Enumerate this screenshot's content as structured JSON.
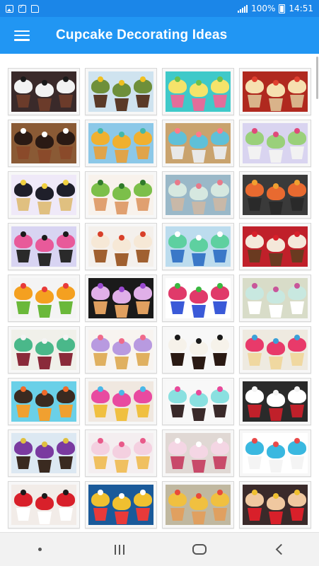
{
  "status_bar": {
    "battery": "100%",
    "time": "14:51",
    "left_icons": [
      "image-icon",
      "check-icon",
      "sd-card-icon"
    ],
    "right_icons": [
      "signal-icon",
      "battery-icon"
    ]
  },
  "app_bar": {
    "title": "Cupcake Decorating Ideas",
    "menu_icon": "hamburger-menu-icon"
  },
  "colors": {
    "status_bar": "#1b86e8",
    "app_bar": "#2196f3",
    "nav_bar": "#f2f2f2"
  },
  "gallery": {
    "columns": 4,
    "visible_rows": 9,
    "items": [
      {
        "bg": "#3a2a2a",
        "frost": "#f2f2f2",
        "liner": "#6b3b2a",
        "top": "#1a1a1a"
      },
      {
        "bg": "#cfe3ef",
        "frost": "#6e8f3a",
        "liner": "#5a3a28",
        "top": "#f0c020"
      },
      {
        "bg": "#3fc9c9",
        "frost": "#f5e36a",
        "liner": "#e36d9a",
        "top": "#6dc04a"
      },
      {
        "bg": "#b0291f",
        "frost": "#f6e0b0",
        "liner": "#d9b38a",
        "top": "#e04030"
      },
      {
        "bg": "#8a5a35",
        "frost": "#2a1a14",
        "liner": "#8a4a2a",
        "top": "#ffffff"
      },
      {
        "bg": "#8cc8e8",
        "frost": "#f0b030",
        "liner": "#e0a44a",
        "top": "#44b8a8"
      },
      {
        "bg": "#c9a36e",
        "frost": "#5fc0d8",
        "liner": "#e8e8e8",
        "top": "#ff7a8a"
      },
      {
        "bg": "#d9d4f0",
        "frost": "#9ad07a",
        "liner": "#f2f2f2",
        "top": "#e04a7a"
      },
      {
        "bg": "#efe9f8",
        "frost": "#1f1f2a",
        "liner": "#e0c080",
        "top": "#f0d040"
      },
      {
        "bg": "#f8f2ec",
        "frost": "#7cbf4a",
        "liner": "#e0a070",
        "top": "#2f7a2a"
      },
      {
        "bg": "#9ab8c8",
        "frost": "#d6e8e0",
        "liner": "#c8b8a8",
        "top": "#e87a8a"
      },
      {
        "bg": "#3a3a3a",
        "frost": "#e86a30",
        "liner": "#2a2a2a",
        "top": "#f0a030"
      },
      {
        "bg": "#d8d4f2",
        "frost": "#e85a9a",
        "liner": "#2a2a2a",
        "top": "#1a1a1a"
      },
      {
        "bg": "#f4f0ec",
        "frost": "#f6e8d6",
        "liner": "#a06030",
        "top": "#d8402a"
      },
      {
        "bg": "#bcdcee",
        "frost": "#5ed0a0",
        "liner": "#3a78c8",
        "top": "#ffffff"
      },
      {
        "bg": "#c0202a",
        "frost": "#f4e8da",
        "liner": "#6a3a20",
        "top": "#d8202a"
      },
      {
        "bg": "#f4f4f4",
        "frost": "#f4a020",
        "liner": "#6ab83a",
        "top": "#e83a3a"
      },
      {
        "bg": "#1a1a1a",
        "frost": "#e0b0e8",
        "liner": "#e0a060",
        "top": "#9a4ad0"
      },
      {
        "bg": "#ffffff",
        "frost": "#e03a6a",
        "liner": "#3a5ad8",
        "top": "#3ab840"
      },
      {
        "bg": "#d8dcc8",
        "frost": "#c8e8e0",
        "liner": "#ffffff",
        "top": "#c8569a"
      },
      {
        "bg": "#f0f0ea",
        "frost": "#4ab88a",
        "liner": "#8a2a3a",
        "top": "#f4f4f4"
      },
      {
        "bg": "#f8f4f0",
        "frost": "#b89ae0",
        "liner": "#e0b060",
        "top": "#f06a8a"
      },
      {
        "bg": "#f8f8f8",
        "frost": "#f6f2ea",
        "liner": "#2a1a14",
        "top": "#1a1a1a"
      },
      {
        "bg": "#eeeae0",
        "frost": "#e83a6a",
        "liner": "#f0d8a0",
        "top": "#3aa0d8"
      },
      {
        "bg": "#6ad0e8",
        "frost": "#3a2a20",
        "liner": "#f0a030",
        "top": "#f06a2a"
      },
      {
        "bg": "#f0e8e0",
        "frost": "#e84aa0",
        "liner": "#f0c040",
        "top": "#4ab8e8"
      },
      {
        "bg": "#f8f8f8",
        "frost": "#8ae0e0",
        "liner": "#3a2a2a",
        "top": "#e84a9a"
      },
      {
        "bg": "#2a2a2a",
        "frost": "#ffffff",
        "liner": "#c0202a",
        "top": "#f4f4f4"
      },
      {
        "bg": "#dce8f2",
        "frost": "#7a3aa0",
        "liner": "#3a2a20",
        "top": "#e0c040"
      },
      {
        "bg": "#f4eef0",
        "frost": "#f4d0e0",
        "liner": "#f0c060",
        "top": "#e85a8a"
      },
      {
        "bg": "#e0d8d4",
        "frost": "#f4d6e4",
        "liner": "#c84a6a",
        "top": "#ffffff"
      },
      {
        "bg": "#ffffff",
        "frost": "#3ab8e0",
        "liner": "#f4f4f4",
        "top": "#e84a4a"
      },
      {
        "bg": "#f2ece8",
        "frost": "#d8202a",
        "liner": "#ffffff",
        "top": "#1a1a1a"
      },
      {
        "bg": "#1a5a9a",
        "frost": "#f0c030",
        "liner": "#e83a3a",
        "top": "#ffffff"
      },
      {
        "bg": "#c0b8a0",
        "frost": "#f0c040",
        "liner": "#e0a060",
        "top": "#e84a3a"
      },
      {
        "bg": "#3a2a2a",
        "frost": "#f0c8a0",
        "liner": "#d8202a",
        "top": "#f0c030"
      }
    ]
  },
  "nav_bar": {
    "buttons": [
      "dot-icon",
      "recents-icon",
      "home-icon",
      "back-icon"
    ]
  }
}
